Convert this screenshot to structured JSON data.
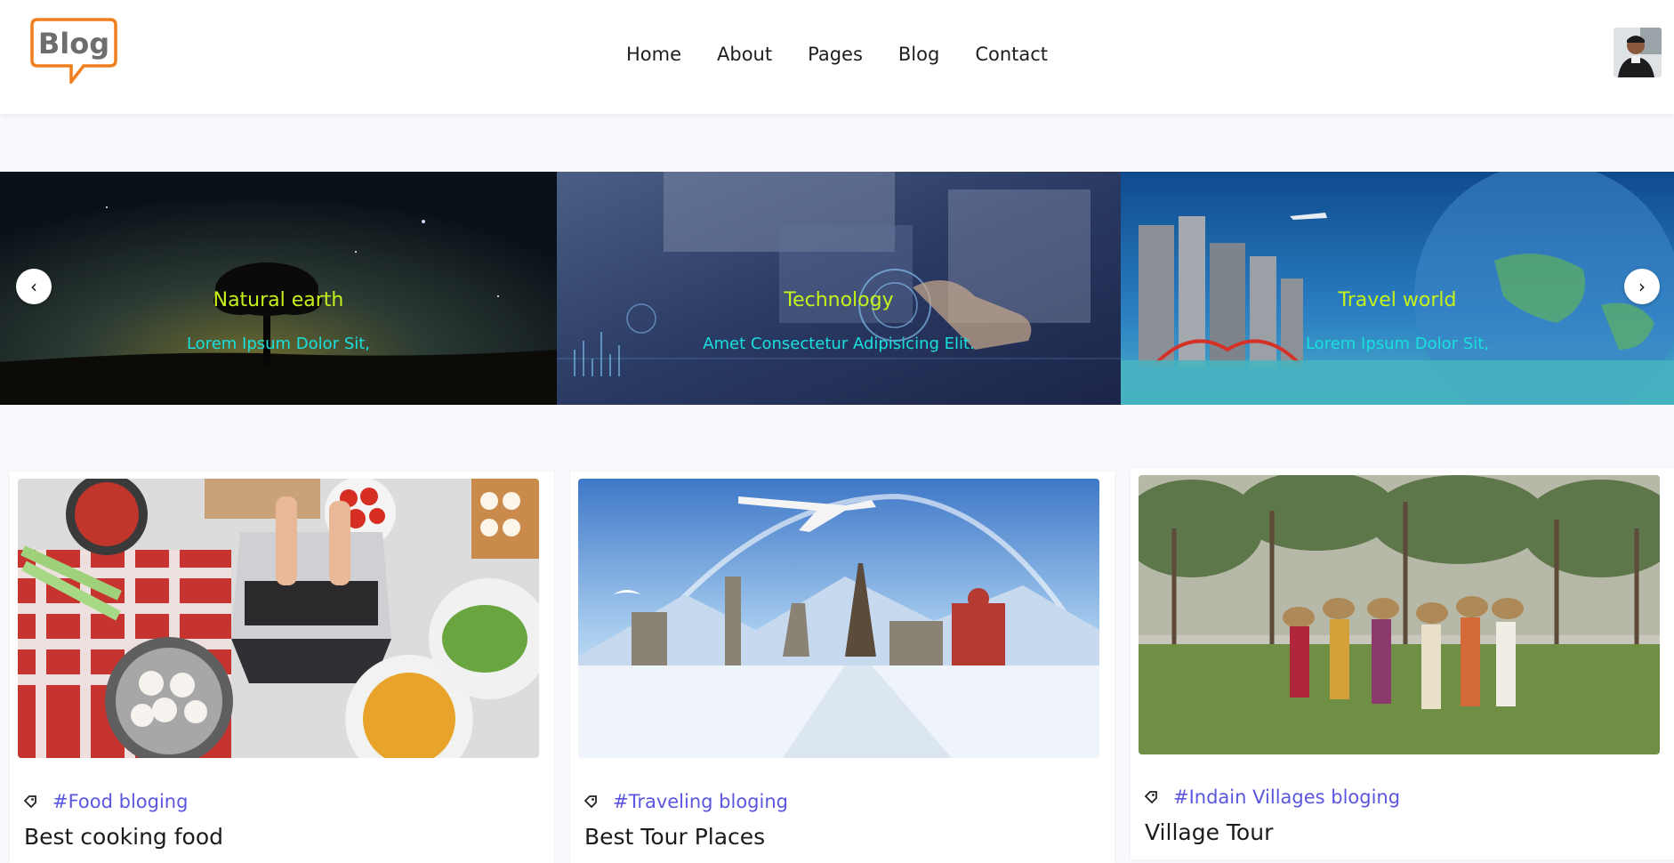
{
  "header": {
    "logo_text": "Blog",
    "nav": [
      {
        "label": "Home"
      },
      {
        "label": "About"
      },
      {
        "label": "Pages"
      },
      {
        "label": "Blog"
      },
      {
        "label": "Contact"
      }
    ]
  },
  "slider": {
    "slides": [
      {
        "title": "Natural earth",
        "subtitle": "Lorem Ipsum Dolor Sit,"
      },
      {
        "title": "Technology",
        "subtitle": "Amet Consectetur Adipisicing Elit."
      },
      {
        "title": "Travel world",
        "subtitle": "Lorem Ipsum Dolor Sit,"
      }
    ],
    "prev_icon": "chevron-left-icon",
    "next_icon": "chevron-right-icon",
    "prev_glyph": "‹",
    "next_glyph": "›"
  },
  "posts": [
    {
      "tag": "#Food bloging",
      "title": "Best cooking food"
    },
    {
      "tag": "#Traveling bloging",
      "title": "Best Tour Places"
    },
    {
      "tag": "#Indain Villages bloging",
      "title": "Village Tour"
    }
  ],
  "colors": {
    "accent": "#5a56e0",
    "slide_title": "#c6f21a",
    "slide_subtitle": "#19e0dd",
    "logo_orange": "#f07e1f"
  }
}
